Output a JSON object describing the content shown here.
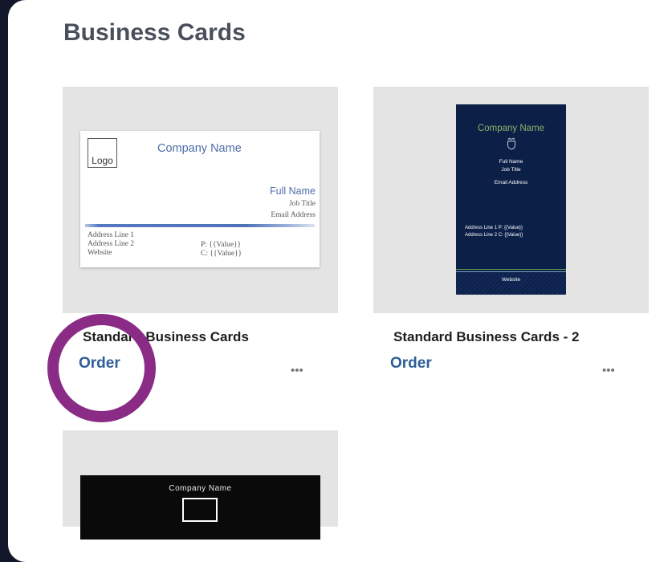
{
  "page": {
    "title": "Business Cards"
  },
  "products": [
    {
      "name": "Standard Business Cards",
      "order_label": "Order",
      "more_label": "•••",
      "card": {
        "logo": "Logo",
        "company": "Company Name",
        "full_name": "Full Name",
        "job_title": "Job Title",
        "email": "Email Address",
        "address1": "Address Line 1",
        "address2": "Address Line 2",
        "website": "Website",
        "phone": "P: {{Value}}",
        "cell": "C: {{Value}}"
      }
    },
    {
      "name": "Standard Business Cards - 2",
      "order_label": "Order",
      "more_label": "•••",
      "card": {
        "company": "Company Name",
        "full_name": "Full Name",
        "job_title": "Job Title",
        "email": "Email Address",
        "address_line_1": "Address Line 1   P: {{Value}}",
        "address_line_2": "Address Line 2   C: {{Value}}",
        "website": "Website"
      }
    },
    {
      "card": {
        "company": "Company Name"
      }
    }
  ],
  "colors": {
    "annotation_circle": "#8a2c86",
    "order_link": "#2e5e97",
    "background": "#111628"
  }
}
